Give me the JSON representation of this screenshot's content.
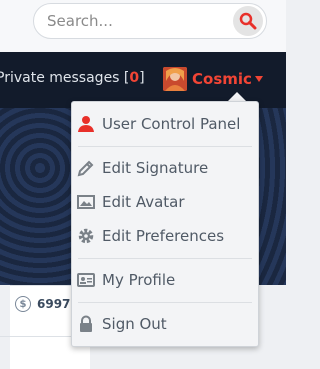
{
  "search": {
    "placeholder": "Search..."
  },
  "navbar": {
    "pm_label": "Private messages [",
    "pm_count": "0",
    "pm_close": "]",
    "username": "Cosmic"
  },
  "stats": {
    "money_value": "6997"
  },
  "menu": {
    "items": [
      {
        "label": "User Control Panel",
        "icon": "user-icon"
      },
      {
        "label": "Edit Signature",
        "icon": "pencil-icon"
      },
      {
        "label": "Edit Avatar",
        "icon": "image-icon"
      },
      {
        "label": "Edit Preferences",
        "icon": "gear-icon"
      },
      {
        "label": "My Profile",
        "icon": "id-card-icon"
      },
      {
        "label": "Sign Out",
        "icon": "lock-icon"
      }
    ]
  },
  "colors": {
    "accent": "#f24535",
    "navbar": "#121b2b",
    "menu_text": "#505a66"
  }
}
